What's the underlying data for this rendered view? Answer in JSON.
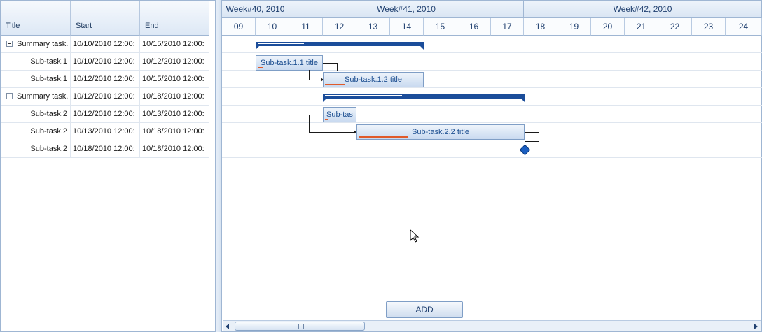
{
  "grid": {
    "columns": [
      "Title",
      "Start",
      "End"
    ],
    "rows": [
      {
        "title": "Summary task.",
        "start": "10/10/2010 12:00:",
        "end": "10/15/2010 12:00:",
        "type": "summary"
      },
      {
        "title": "Sub-task.1",
        "start": "10/10/2010 12:00:",
        "end": "10/12/2010 12:00:",
        "type": "sub"
      },
      {
        "title": "Sub-task.1",
        "start": "10/12/2010 12:00:",
        "end": "10/15/2010 12:00:",
        "type": "sub"
      },
      {
        "title": "Summary task.",
        "start": "10/12/2010 12:00:",
        "end": "10/18/2010 12:00:",
        "type": "summary"
      },
      {
        "title": "Sub-task.2",
        "start": "10/12/2010 12:00:",
        "end": "10/13/2010 12:00:",
        "type": "sub"
      },
      {
        "title": "Sub-task.2",
        "start": "10/13/2010 12:00:",
        "end": "10/18/2010 12:00:",
        "type": "sub"
      },
      {
        "title": "Sub-task.2",
        "start": "10/18/2010 12:00:",
        "end": "10/18/2010 12:00:",
        "type": "sub"
      }
    ]
  },
  "timeline": {
    "weeks": [
      "Week#40, 2010",
      "Week#41, 2010",
      "Week#42, 2010"
    ],
    "days": [
      "09",
      "10",
      "11",
      "12",
      "13",
      "14",
      "15",
      "16",
      "17",
      "18",
      "19",
      "20",
      "21",
      "22",
      "23",
      "24"
    ]
  },
  "bars": {
    "task_1_1": "Sub-task.1.1 title",
    "task_1_2": "Sub-task.1.2 title",
    "task_2_1": "Sub-tas",
    "task_2_2": "Sub-task.2.2 title"
  },
  "actions": {
    "add_label": "ADD"
  },
  "colors": {
    "summary_bar": "#1b4d9a",
    "progress": "#e05a2a",
    "milestone": "#1b5fc1"
  },
  "icons": {
    "expander": "collapse-minus-icon",
    "milestone": "diamond-milestone-icon",
    "cursor": "mouse-pointer-icon"
  }
}
